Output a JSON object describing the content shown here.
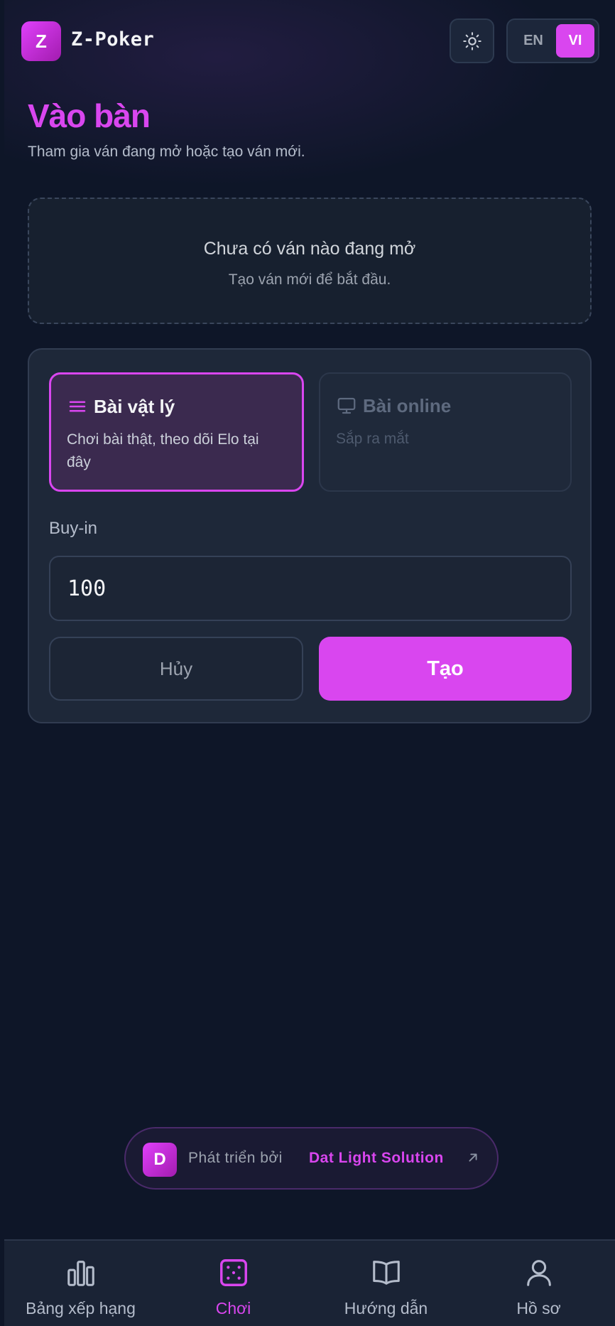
{
  "header": {
    "logo_letter": "Z",
    "brand": "Z-Poker",
    "theme_icon": "sun-icon",
    "lang": {
      "en": "EN",
      "vi": "VI",
      "active": "VI"
    }
  },
  "page": {
    "title": "Vào bàn",
    "subtitle": "Tham gia ván đang mở hoặc tạo ván mới."
  },
  "empty_state": {
    "title": "Chưa có ván nào đang mở",
    "subtitle": "Tạo ván mới để bắt đầu."
  },
  "create_form": {
    "options": [
      {
        "icon": "menu-lines-icon",
        "title": "Bài vật lý",
        "desc": "Chơi bài thật, theo dõi Elo tại đây",
        "selected": true
      },
      {
        "icon": "monitor-icon",
        "title": "Bài online",
        "desc": "Sắp ra mắt",
        "selected": false
      }
    ],
    "buyin_label": "Buy-in",
    "buyin_value": "100",
    "cancel_label": "Hủy",
    "create_label": "Tạo"
  },
  "credit": {
    "badge": "D",
    "text": "Phát triển bởi",
    "link": "Dat Light Solution",
    "icon": "arrow-up-right-icon"
  },
  "bottom_nav": [
    {
      "label": "Bảng xếp hạng",
      "icon": "bar-chart-icon",
      "active": false
    },
    {
      "label": "Chơi",
      "icon": "dice-icon",
      "active": true
    },
    {
      "label": "Hướng dẫn",
      "icon": "book-icon",
      "active": false
    },
    {
      "label": "Hồ sơ",
      "icon": "user-icon",
      "active": false
    }
  ],
  "colors": {
    "accent": "#d946ef",
    "background": "#0e1628",
    "card": "#1e2839"
  }
}
